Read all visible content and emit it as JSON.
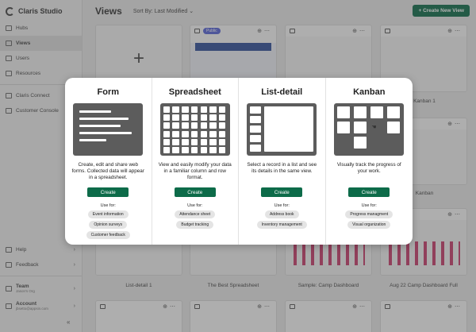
{
  "app": {
    "name": "Claris Studio"
  },
  "sidebar": {
    "items": [
      {
        "label": "Hubs",
        "icon": "hub-icon"
      },
      {
        "label": "Views",
        "icon": "views-icon",
        "active": true
      },
      {
        "label": "Users",
        "icon": "users-icon"
      },
      {
        "label": "Resources",
        "icon": "resources-icon"
      }
    ],
    "secondary": [
      {
        "label": "Claris Connect",
        "icon": "connect-icon"
      },
      {
        "label": "Customer Console",
        "icon": "console-icon"
      }
    ],
    "bottom": [
      {
        "label": "Help",
        "icon": "help-icon"
      },
      {
        "label": "Feedback",
        "icon": "feedback-icon"
      }
    ],
    "team": {
      "label": "Team",
      "sub": "Jason's Org"
    },
    "account": {
      "label": "Account",
      "sub": "jbsetto@appsin.com"
    },
    "collapse": "«"
  },
  "header": {
    "title": "Views",
    "sort_label": "Sort By: Last Modified",
    "new_view_label": "+ Create New View"
  },
  "cards": {
    "public_badge": "Public",
    "titles": [
      "Kanban 1",
      "Kanban",
      "List-detail 1",
      "The Best Spreadsheet",
      "Sample: Camp Dashboard",
      "Aug 22 Camp Dashboard Full"
    ]
  },
  "modal": {
    "use_for_label": "Use for:",
    "create_label": "Create",
    "columns": [
      {
        "title": "Form",
        "description": "Create, edit and share web forms. Collected data will appear in a spreadsheet.",
        "uses": [
          "Event information",
          "Opinion surveys",
          "Customer feedback"
        ]
      },
      {
        "title": "Spreadsheet",
        "description": "View and easily modify your data in a familiar column and row format.",
        "uses": [
          "Attendance sheet",
          "Budget tracking"
        ]
      },
      {
        "title": "List-detail",
        "description": "Select a record in a list and see its details in the same view.",
        "uses": [
          "Address book",
          "Inventory management"
        ]
      },
      {
        "title": "Kanban",
        "description": "Visually track the progress of your work.",
        "uses": [
          "Progress managment",
          "Visual organization"
        ]
      }
    ]
  },
  "colors": {
    "accent": "#0d6b49",
    "public_badge": "#5562d8",
    "thumb": "#5c5c5c"
  }
}
